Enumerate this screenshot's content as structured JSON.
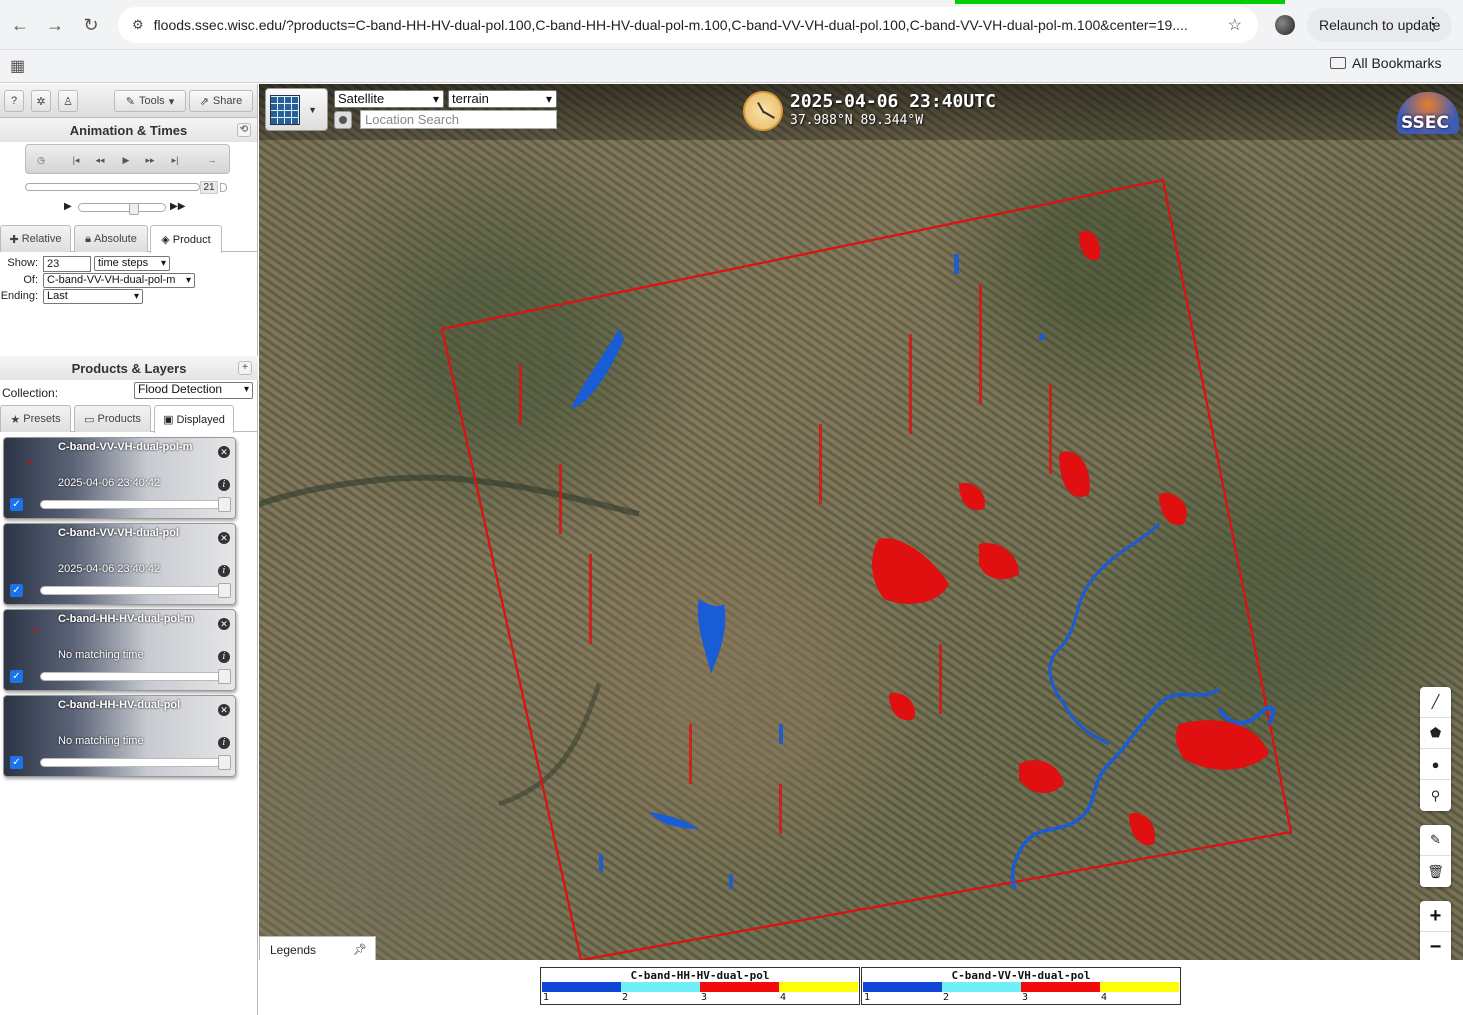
{
  "browser": {
    "url": "floods.ssec.wisc.edu/?products=C-band-HH-HV-dual-pol.100,C-band-HH-HV-dual-pol-m.100,C-band-VV-VH-dual-pol.100,C-band-VV-VH-dual-pol-m.100&center=19....",
    "relaunch_label": "Relaunch to update",
    "all_bookmarks_label": "All Bookmarks"
  },
  "toolbar": {
    "help_label": "?",
    "tools_label": "Tools",
    "share_label": "Share"
  },
  "animation": {
    "title": "Animation & Times",
    "timeline_value": "21",
    "tabs": [
      {
        "label": "Relative"
      },
      {
        "label": "Absolute"
      },
      {
        "label": "Product"
      }
    ],
    "show_label": "Show:",
    "show_value": "23",
    "show_unit": "time steps",
    "of_label": "Of:",
    "of_value": "C-band-VV-VH-dual-pol-m",
    "ending_label": "Ending:",
    "ending_value": "Last"
  },
  "products": {
    "title": "Products & Layers",
    "collection_label": "Collection:",
    "collection_value": "Flood Detection",
    "tabs": [
      {
        "label": "Presets"
      },
      {
        "label": "Products"
      },
      {
        "label": "Displayed"
      }
    ],
    "layers": [
      {
        "name": "C-band-VV-VH-dual-pol-m",
        "time": "2025-04-06 23:40:42",
        "opacity": 1.0
      },
      {
        "name": "C-band-VV-VH-dual-pol",
        "time": "2025-04-06 23:40:42",
        "opacity": 1.0
      },
      {
        "name": "C-band-HH-HV-dual-pol-m",
        "time": "No matching time",
        "opacity": 1.0
      },
      {
        "name": "C-band-HH-HV-dual-pol",
        "time": "No matching time",
        "opacity": 1.0
      }
    ]
  },
  "map": {
    "basemap": "Satellite",
    "overlay": "terrain",
    "search_placeholder": "Location Search",
    "datetime": "2025-04-06 23:40UTC",
    "coords": "37.988°N 89.344°W",
    "logo_text": "SSEC",
    "zoom_in": "+",
    "zoom_out": "−"
  },
  "legends": {
    "tab_label": "Legends",
    "bars": [
      {
        "title": "C-band-HH-HV-dual-pol",
        "ticks": [
          "1",
          "2",
          "3",
          "4"
        ],
        "colors": [
          "#1046d8",
          "#6ff0f7",
          "#f20b0b",
          "#fdfd06"
        ]
      },
      {
        "title": "C-band-VV-VH-dual-pol",
        "ticks": [
          "1",
          "2",
          "3",
          "4"
        ],
        "colors": [
          "#1046d8",
          "#6ff0f7",
          "#f20b0b",
          "#fdfd06"
        ]
      }
    ]
  }
}
